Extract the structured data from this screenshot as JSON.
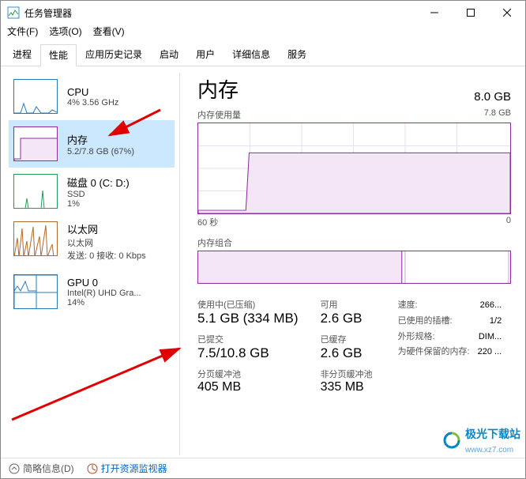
{
  "window": {
    "title": "任务管理器"
  },
  "menus": {
    "file": "文件(F)",
    "options": "选项(O)",
    "view": "查看(V)"
  },
  "tabs": {
    "processes": "进程",
    "performance": "性能",
    "app_history": "应用历史记录",
    "startup": "启动",
    "users": "用户",
    "details": "详细信息",
    "services": "服务"
  },
  "sidebar": {
    "cpu": {
      "name": "CPU",
      "sub": "4%  3.56 GHz"
    },
    "mem": {
      "name": "内存",
      "sub": "5.2/7.8 GB (67%)"
    },
    "disk": {
      "name": "磁盘 0 (C: D:)",
      "sub": "SSD",
      "sub2": "1%"
    },
    "net": {
      "name": "以太网",
      "sub": "以太网",
      "sub2": "发送: 0 接收: 0 Kbps"
    },
    "gpu": {
      "name": "GPU 0",
      "sub": "Intel(R) UHD Gra...",
      "sub2": "14%"
    }
  },
  "main": {
    "title": "内存",
    "capacity": "8.0 GB",
    "usage_label": "内存使用量",
    "usage_max": "7.8 GB",
    "x_left": "60 秒",
    "x_right": "0",
    "comp_label": "内存组合"
  },
  "stats": {
    "in_use_label": "使用中(已压缩)",
    "in_use_value": "5.1 GB (334 MB)",
    "available_label": "可用",
    "available_value": "2.6 GB",
    "committed_label": "已提交",
    "committed_value": "7.5/10.8 GB",
    "cached_label": "已缓存",
    "cached_value": "2.6 GB",
    "paged_label": "分页缓冲池",
    "paged_value": "405 MB",
    "nonpaged_label": "非分页缓冲池",
    "nonpaged_value": "335 MB"
  },
  "right_stats": {
    "speed_label": "速度:",
    "speed_value": "266...",
    "slots_label": "已使用的插槽:",
    "slots_value": "1/2",
    "form_label": "外形规格:",
    "form_value": "DIM...",
    "reserved_label": "为硬件保留的内存:",
    "reserved_value": "220 ..."
  },
  "footer": {
    "brief": "简略信息(D)",
    "open_resmon": "打开资源监视器"
  },
  "watermark": {
    "brand": "极光下载站",
    "url": "www.xz7.com"
  },
  "chart_data": {
    "type": "area",
    "title": "内存使用量",
    "xlabel": "60 秒 → 0",
    "ylabel": "GB",
    "ylim": [
      0,
      7.8
    ],
    "x_seconds": [
      60,
      50,
      49,
      0
    ],
    "values_gb": [
      0.3,
      0.3,
      5.2,
      5.2
    ],
    "composition": {
      "type": "stacked-bar",
      "segments": [
        {
          "name": "in_use",
          "gb": 5.1
        },
        {
          "name": "modified",
          "gb": 0.1
        },
        {
          "name": "standby",
          "gb": 2.6
        },
        {
          "name": "free",
          "gb": 0.0
        }
      ],
      "total_gb": 7.8
    }
  }
}
